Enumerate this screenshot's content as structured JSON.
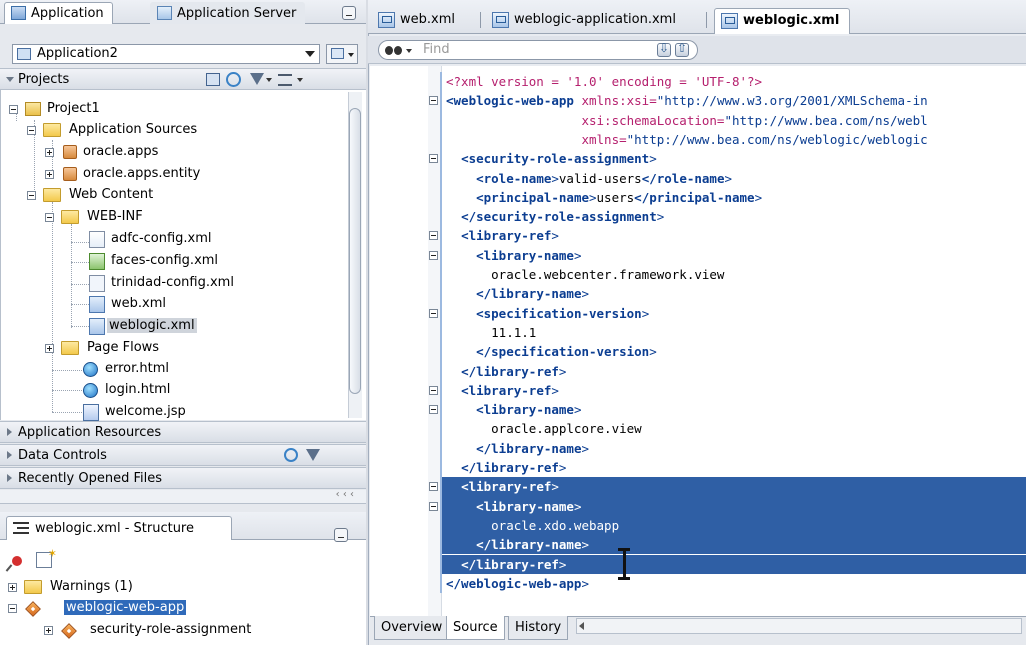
{
  "navigator": {
    "tabs": [
      "Application",
      "Application Server"
    ],
    "app_selector": "Application2",
    "projects_header": "Projects",
    "tree": [
      {
        "label": "Project1"
      },
      {
        "label": "Application Sources"
      },
      {
        "label": "oracle.apps"
      },
      {
        "label": "oracle.apps.entity"
      },
      {
        "label": "Web Content"
      },
      {
        "label": "WEB-INF"
      },
      {
        "label": "adfc-config.xml"
      },
      {
        "label": "faces-config.xml"
      },
      {
        "label": "trinidad-config.xml"
      },
      {
        "label": "web.xml"
      },
      {
        "label": "weblogic.xml"
      },
      {
        "label": "Page Flows"
      },
      {
        "label": "error.html"
      },
      {
        "label": "login.html"
      },
      {
        "label": "welcome.jsp"
      }
    ],
    "sections": [
      "Application Resources",
      "Data Controls",
      "Recently Opened Files"
    ],
    "scroll_hint": "‹ ‹ ‹"
  },
  "structure": {
    "tab_label": "weblogic.xml - Structure",
    "items": [
      "Warnings (1)",
      "weblogic-web-app",
      "security-role-assignment"
    ]
  },
  "editor": {
    "tabs": [
      "web.xml",
      "weblogic-application.xml",
      "weblogic.xml"
    ],
    "active_tab": "weblogic.xml",
    "find_placeholder": "Find",
    "bottom_tabs": [
      "Overview",
      "Source",
      "History"
    ],
    "lines": [
      "<?xml version = '1.0' encoding = 'UTF-8'?>",
      "<weblogic-web-app xmlns:xsi=\"http://www.w3.org/2001/XMLSchema-in",
      "                  xsi:schemaLocation=\"http://www.bea.com/ns/webl",
      "                  xmlns=\"http://www.bea.com/ns/weblogic/weblogic",
      "  <security-role-assignment>",
      "    <role-name>valid-users</role-name>",
      "    <principal-name>users</principal-name>",
      "  </security-role-assignment>",
      "  <library-ref>",
      "    <library-name>",
      "      oracle.webcenter.framework.view",
      "    </library-name>",
      "    <specification-version>",
      "      11.1.1",
      "    </specification-version>",
      "  </library-ref>",
      "  <library-ref>",
      "    <library-name>",
      "      oracle.applcore.view",
      "    </library-name>",
      "  </library-ref>",
      "  <library-ref>",
      "    <library-name>",
      "      oracle.xdo.webapp",
      "    </library-name>",
      "  </library-ref>",
      "</weblogic-web-app>"
    ]
  },
  "colors": {
    "selection": "#2f5fa5",
    "tag": "#0b3d91",
    "attribute": "#b5206e",
    "highlight": "#2f6aba"
  }
}
